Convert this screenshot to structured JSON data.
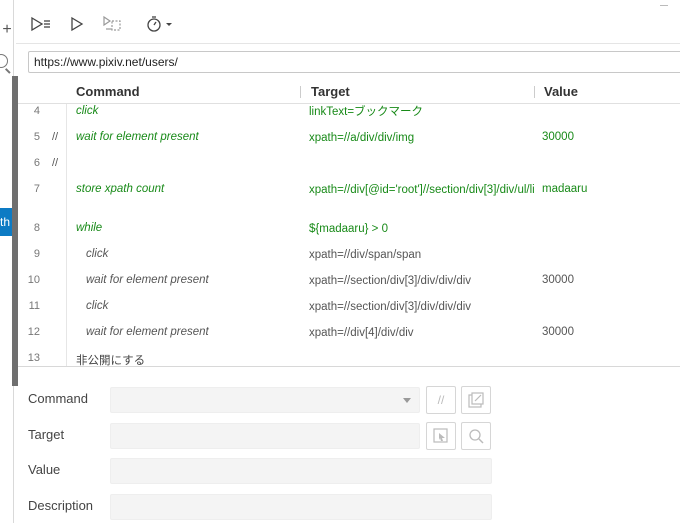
{
  "sidebar": {
    "tab_label": "th"
  },
  "toolbar": {
    "buttons": [
      "run-all-tests",
      "run-current-test",
      "step-over",
      "timing"
    ]
  },
  "url": "https://www.pixiv.net/users/",
  "table": {
    "headers": {
      "command": "Command",
      "target": "Target",
      "value": "Value"
    },
    "rows": [
      {
        "line": "4",
        "comment": "",
        "command": "click",
        "target": "linkText=ブックマーク",
        "value": "",
        "color": "green",
        "indent": 0
      },
      {
        "line": "5",
        "comment": "//",
        "command": "wait for element present",
        "target": "xpath=//a/div/div/img",
        "value": "30000",
        "color": "green",
        "indent": 0
      },
      {
        "line": "6",
        "comment": "//",
        "command": "",
        "target": "",
        "value": "",
        "color": "green",
        "indent": 0
      },
      {
        "line": "7",
        "comment": "",
        "command": "store xpath count",
        "target": "xpath=//div[@id='root']//section/div[3]/div/ul/li",
        "value": "madaaru",
        "color": "green",
        "indent": 0
      },
      {
        "line": "8",
        "comment": "",
        "command": "while",
        "target": "${madaaru} > 0",
        "value": "",
        "color": "green",
        "indent": 0
      },
      {
        "line": "9",
        "comment": "",
        "command": "click",
        "target": "xpath=//div/span/span",
        "value": "",
        "color": "gray",
        "indent": 1
      },
      {
        "line": "10",
        "comment": "",
        "command": "wait for element present",
        "target": "xpath=//section/div[3]/div/div/div",
        "value": "30000",
        "color": "gray",
        "indent": 1
      },
      {
        "line": "11",
        "comment": "",
        "command": "click",
        "target": "xpath=//section/div[3]/div/div/div",
        "value": "",
        "color": "gray",
        "indent": 1
      },
      {
        "line": "12",
        "comment": "",
        "command": "wait for element present",
        "target": "xpath=//div[4]/div/div",
        "value": "30000",
        "color": "gray",
        "indent": 1
      },
      {
        "line": "13",
        "comment": "",
        "command": "非公開にする",
        "target": "",
        "value": "",
        "color": "plain",
        "indent": 0
      }
    ]
  },
  "editor": {
    "command_label": "Command",
    "target_label": "Target",
    "value_label": "Value",
    "description_label": "Description",
    "comment_button": "//"
  }
}
